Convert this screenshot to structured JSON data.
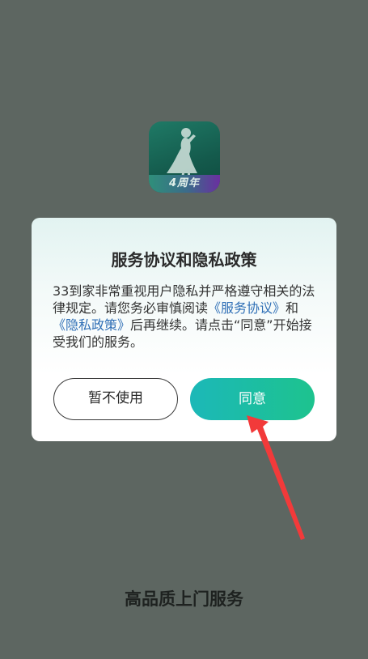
{
  "app_icon": {
    "badge_text": "4周年",
    "icon": "woman-silhouette-icon"
  },
  "dialog": {
    "title": "服务协议和隐私政策",
    "body": {
      "part1": "33到家非常重视用户隐私并严格遵守相关的法律规定。请您务必审慎阅读",
      "link_service": "《服务协议》",
      "conj": "和",
      "link_privacy": "《隐私政策》",
      "part2": "后再继续。请点击“同意”开始接受我们的服务。"
    },
    "decline_label": "暂不使用",
    "agree_label": "同意"
  },
  "tagline": "高品质上门服务",
  "colors": {
    "background": "#5d6661",
    "link": "#2f6fb6",
    "agree_gradient_start": "#1cb8b8",
    "agree_gradient_end": "#1dc38e",
    "arrow": "#f23a3a"
  }
}
